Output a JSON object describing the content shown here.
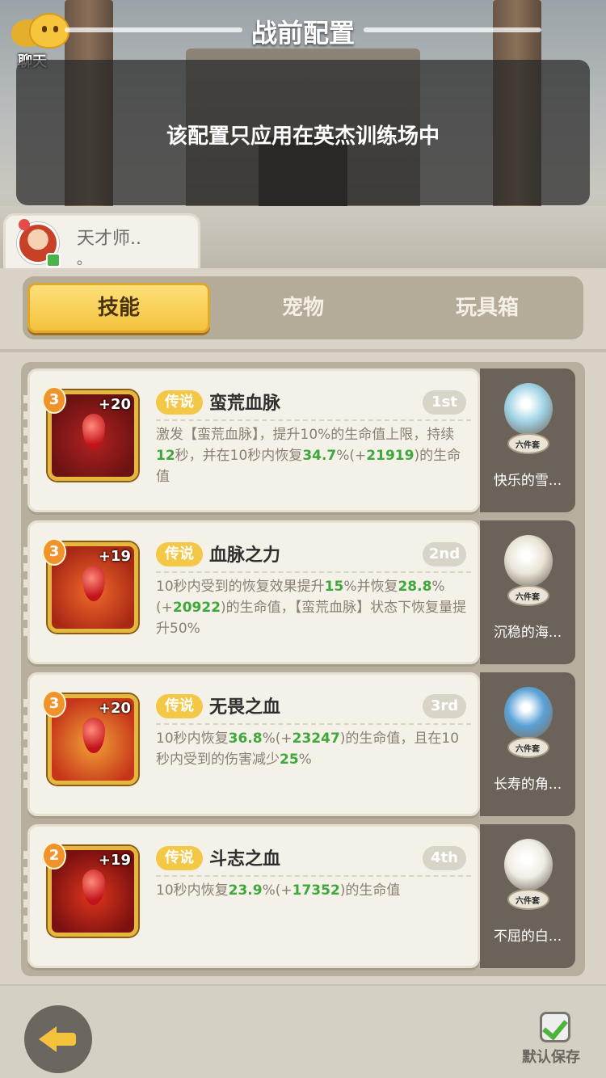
{
  "header": {
    "title": "战前配置",
    "chat_label": "聊天",
    "notice": "该配置只应用在英杰训练场中"
  },
  "profile": {
    "name": "天才师..",
    "subtitle": "。"
  },
  "tabs": [
    {
      "label": "技能",
      "active": true
    },
    {
      "label": "宠物",
      "active": false
    },
    {
      "label": "玩具箱",
      "active": false
    }
  ],
  "skills": [
    {
      "level": "3",
      "bonus": "+20",
      "rarity": "传说",
      "name": "蛮荒血脉",
      "rank": "1st",
      "desc": [
        "激发【蛮荒血脉】，提升10%的生命值上限，持续",
        "12",
        "秒，并在10秒内恢复",
        "34.7",
        "%(+",
        "21919",
        ")的生命值"
      ],
      "pet": {
        "set": "六件套",
        "name": "快乐的雪..."
      }
    },
    {
      "level": "3",
      "bonus": "+19",
      "rarity": "传说",
      "name": "血脉之力",
      "rank": "2nd",
      "desc": [
        "10秒内受到的恢复效果提升",
        "15",
        "%并恢复",
        "28.8",
        "%(+",
        "20922",
        ")的生命值，【蛮荒血脉】状态下恢复量提升50%"
      ],
      "pet": {
        "set": "六件套",
        "name": "沉稳的海..."
      }
    },
    {
      "level": "3",
      "bonus": "+20",
      "rarity": "传说",
      "name": "无畏之血",
      "rank": "3rd",
      "desc": [
        "10秒内恢复",
        "36.8",
        "%(+",
        "23247",
        ")的生命值，且在10秒内受到的伤害减少",
        "25",
        "%"
      ],
      "pet": {
        "set": "六件套",
        "name": "长寿的角..."
      }
    },
    {
      "level": "2",
      "bonus": "+19",
      "rarity": "传说",
      "name": "斗志之血",
      "rank": "4th",
      "desc": [
        "10秒内恢复",
        "23.9",
        "%(+",
        "17352",
        ")的生命值"
      ],
      "pet": {
        "set": "六件套",
        "name": "不屈的白..."
      }
    }
  ],
  "footer": {
    "save_label": "默认保存",
    "save_checked": true
  },
  "colors": {
    "accent": "#f4c23c",
    "highlight_green": "#3fa83a",
    "rarity_gold": "#f3c846"
  }
}
